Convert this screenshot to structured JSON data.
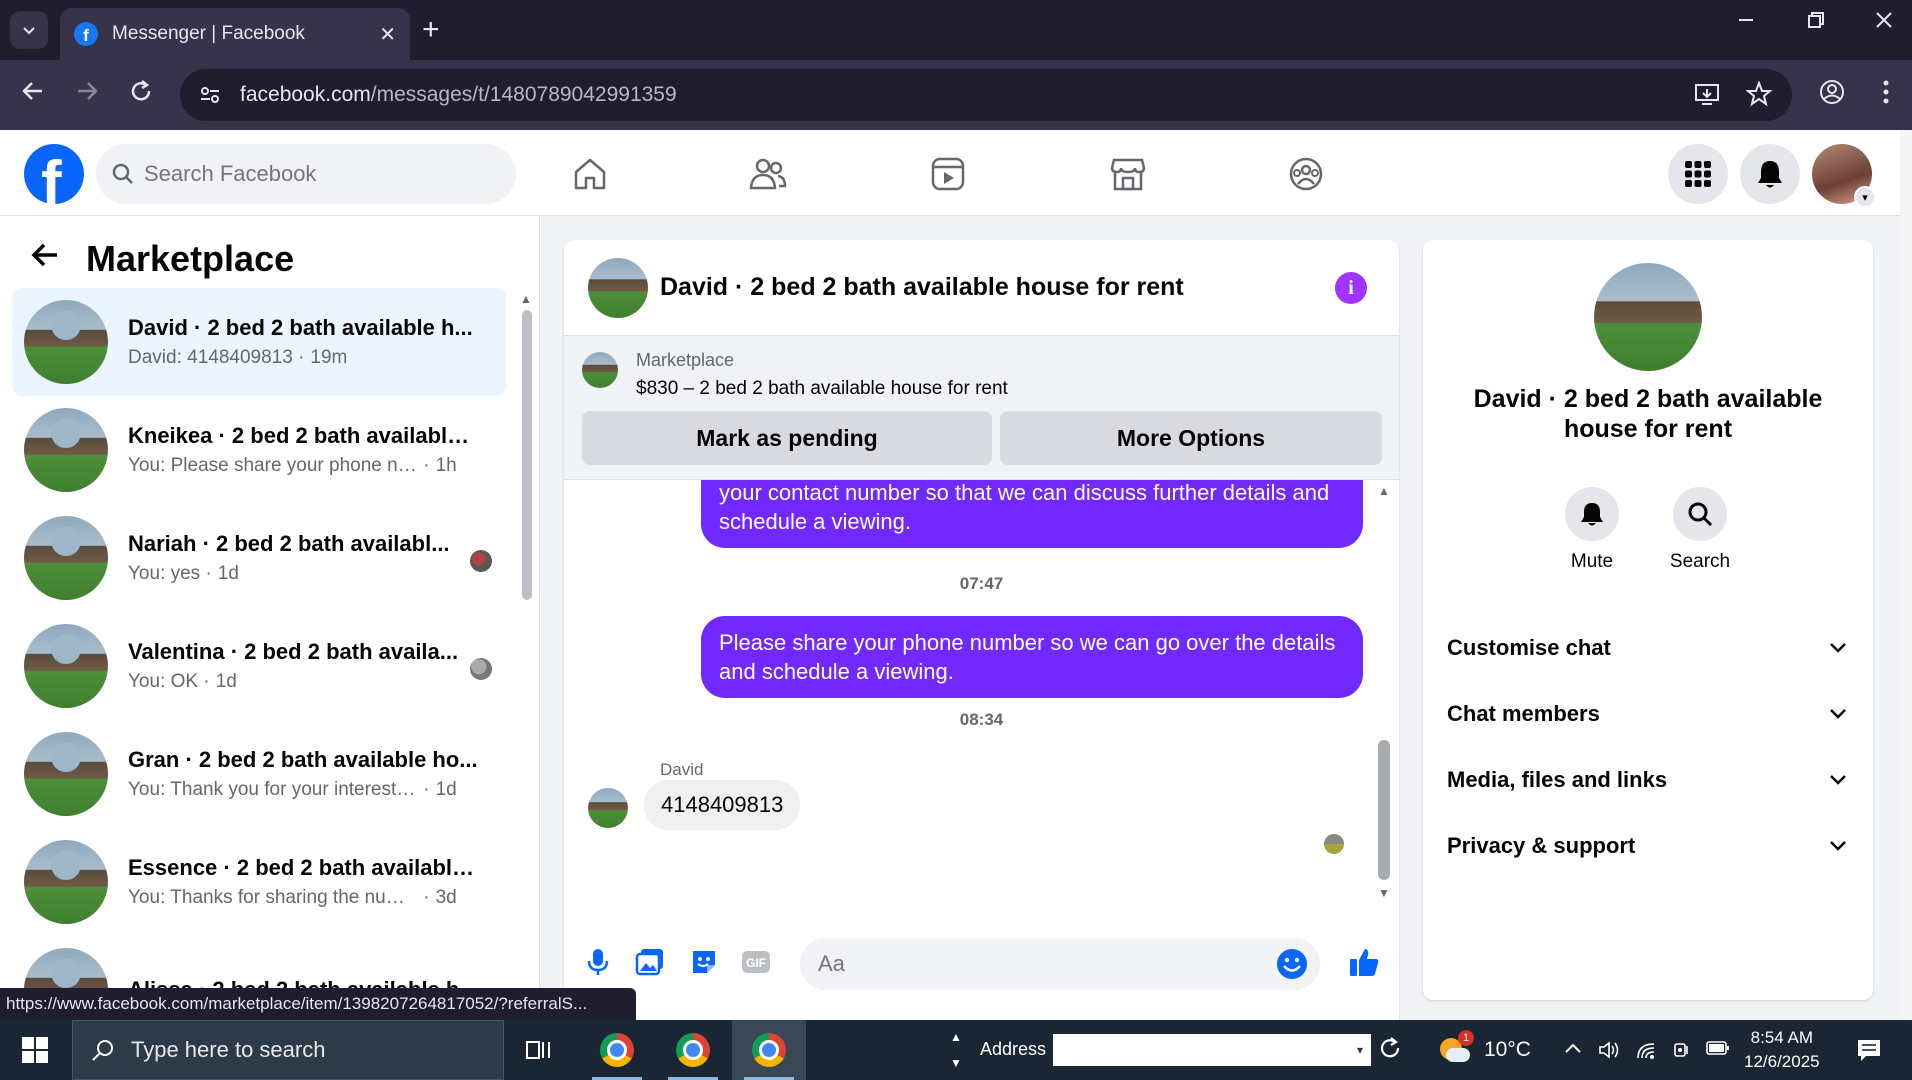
{
  "browser": {
    "tab_title": "Messenger | Facebook",
    "url_host": "facebook.com",
    "url_path": "/messages/t/1480789042991359",
    "status_url": "https://www.facebook.com/marketplace/item/1398207264817052/?referralS..."
  },
  "fb_header": {
    "search_placeholder": "Search Facebook",
    "nav_icons": [
      "home-icon",
      "friends-icon",
      "video-icon",
      "marketplace-icon",
      "groups-icon"
    ],
    "brand_color": "#0866ff"
  },
  "left_panel": {
    "title": "Marketplace",
    "conversations": [
      {
        "name": "David · 2 bed 2 bath available h...",
        "preview": "David: 4148409813",
        "time": "19m",
        "active": true
      },
      {
        "name": "Kneikea · 2 bed 2 bath available ...",
        "preview": "You: Please share your phone num...",
        "time": "1h"
      },
      {
        "name": "Nariah · 2 bed 2 bath availabl...",
        "preview": "You: yes",
        "time": "1d"
      },
      {
        "name": "Valentina · 2 bed 2 bath availa...",
        "preview": "You: OK",
        "time": "1d"
      },
      {
        "name": "Gran · 2 bed 2 bath available ho...",
        "preview": "You: Thank you for your interest! Ye...",
        "time": "1d"
      },
      {
        "name": "Essence · 2 bed 2 bath available ...",
        "preview": "You: Thanks for sharing the numbe...",
        "time": "3d"
      },
      {
        "name": "Alissa · 2 bed 2 bath available h...",
        "preview": "",
        "time": ""
      }
    ]
  },
  "chat": {
    "title": "David · 2 bed 2 bath available house for rent",
    "marketplace_label": "Marketplace",
    "listing": "$830 – 2 bed 2 bath available house for rent",
    "mark_pending": "Mark as pending",
    "more_options": "More Options",
    "messages": {
      "out1": "your contact number so that we can discuss further details and schedule a viewing.",
      "time1": "07:47",
      "out2": "Please share your phone number so we can go over the details and schedule a viewing.",
      "time2": "08:34",
      "sender": "David",
      "in1": "4148409813"
    },
    "composer_placeholder": "Aa",
    "accent_color": "#7129ff"
  },
  "right_panel": {
    "title": "David · 2 bed 2 bath available house for rent",
    "mute": "Mute",
    "search": "Search",
    "sections": [
      "Customise chat",
      "Chat members",
      "Media, files and links",
      "Privacy & support"
    ]
  },
  "taskbar": {
    "search_placeholder": "Type here to search",
    "address_label": "Address",
    "weather_temp": "10°C",
    "weather_badge": "1",
    "time": "8:54 AM",
    "date": "12/6/2025"
  }
}
